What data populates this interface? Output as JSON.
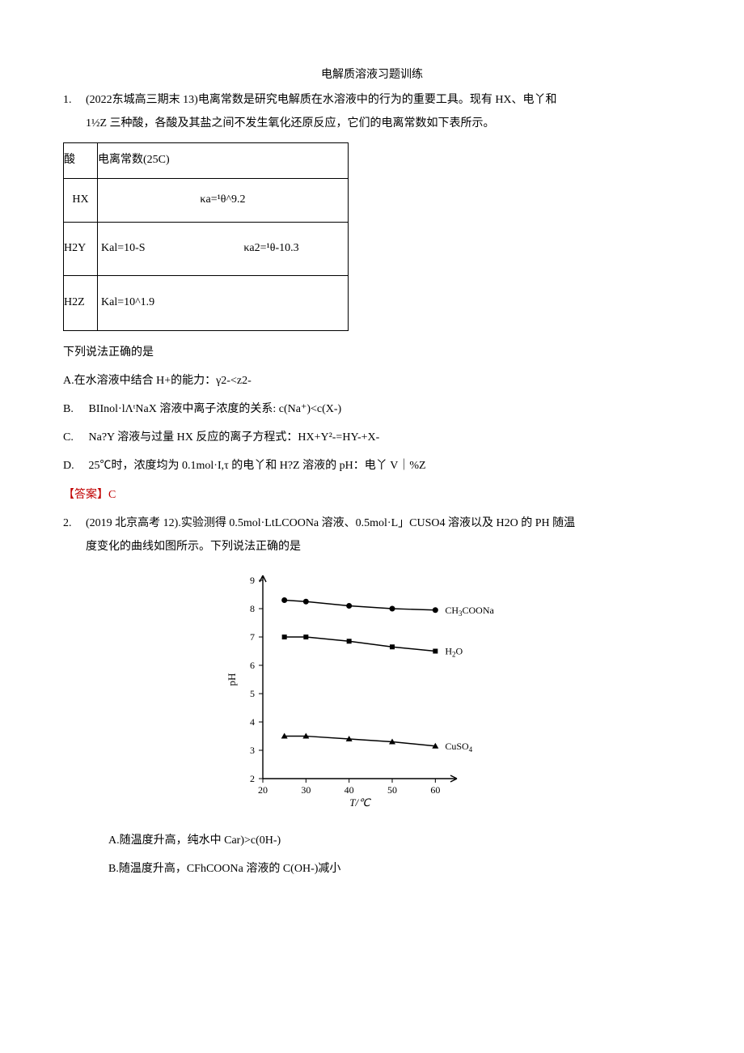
{
  "title": "电解质溶液习题训练",
  "q1": {
    "num": "1.",
    "line1": "(2022东城高三期末 13)电离常数是研究电解质在水溶液中的行为的重要工具。现有 HX、电丫和",
    "line2": "1½Z 三种酸，各酸及其盐之间不发生氧化还原反应，它们的电离常数如下表所示。",
    "table": {
      "h_acid": "酸",
      "h_const": "电离常数(25C)",
      "r1_acid": "HX",
      "r1_k": "κa=¹θ^9.2",
      "r2_acid": "H2Y",
      "r2_k1": "Kal=10-S",
      "r2_k2": "κa2=¹θ-10.3",
      "r3_acid": "H2Z",
      "r3_k1": "Kal=10^1.9"
    },
    "stem": "下列说法正确的是",
    "optA": "A.在水溶液中结合 H+的能力：γ2-<z2-",
    "optB_lbl": "B.",
    "optB": "BIInol·lΛᵗNaX 溶液中离子浓度的关系: c(Na⁺)<c(X-)",
    "optC_lbl": "C.",
    "optC": "Na?Y 溶液与过量 HX 反应的离子方程式：HX+Y²-=HY-+X-",
    "optD_lbl": "D.",
    "optD": "25℃时，浓度均为 0.1mol·I,τ 的电丫和 H?Z 溶液的 pH：电丫 V｜%Z",
    "answer": "【答案】C"
  },
  "q2": {
    "num": "2.",
    "line1": "(2019 北京高考 12).实验测得 0.5mol·LtLCOONa 溶液、0.5mol·L」CUSO4 溶液以及 H2O 的 PH 随温",
    "line2": "度变化的曲线如图所示。下列说法正确的是",
    "optA": "A.随温度升高，纯水中 Car)>c(0H-)",
    "optB": "B.随温度升高，CFhCOONa 溶液的 C(OH-)减小"
  },
  "chart_data": {
    "type": "line",
    "xlabel": "T/℃",
    "ylabel": "pH",
    "xlim": [
      20,
      65
    ],
    "ylim": [
      2,
      9
    ],
    "x_ticks": [
      20,
      30,
      40,
      50,
      60
    ],
    "y_ticks": [
      2,
      3,
      4,
      5,
      6,
      7,
      8,
      9
    ],
    "x": [
      25,
      30,
      40,
      50,
      60
    ],
    "series": [
      {
        "name": "CH₃COONa",
        "marker": "circle",
        "values": [
          8.3,
          8.25,
          8.1,
          8.0,
          7.95
        ]
      },
      {
        "name": "H₂O",
        "marker": "square",
        "values": [
          7.0,
          7.0,
          6.85,
          6.65,
          6.5
        ]
      },
      {
        "name": "CuSO₄",
        "marker": "triangle",
        "values": [
          3.5,
          3.5,
          3.4,
          3.3,
          3.15
        ]
      }
    ]
  }
}
